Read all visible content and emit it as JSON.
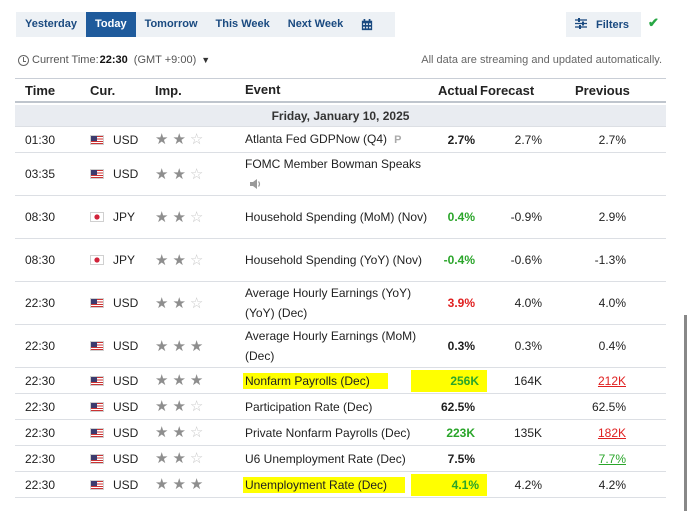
{
  "nav": {
    "tabs": [
      "Yesterday",
      "Today",
      "Tomorrow",
      "This Week",
      "Next Week"
    ],
    "active": "Today",
    "calendar_icon": "calendar-icon",
    "filters_label": "Filters",
    "filters_icon": "sliders-icon",
    "check_icon": "checkmark-icon"
  },
  "timebar": {
    "label": "Current Time:",
    "time": "22:30",
    "tz": "(GMT +9:00)",
    "streaming": "All data are streaming and updated automatically."
  },
  "columns": {
    "time": "Time",
    "cur": "Cur.",
    "imp": "Imp.",
    "event": "Event",
    "actual": "Actual",
    "forecast": "Forecast",
    "previous": "Previous"
  },
  "date_header": "Friday, January 10, 2025",
  "rows": [
    {
      "time": "01:30",
      "cur": "USD",
      "stars": 2,
      "event": "Atlanta Fed GDPNow (Q4)",
      "marker": "P",
      "actual": "2.7%",
      "forecast": "2.7%",
      "previous": "2.7%"
    },
    {
      "time": "03:35",
      "cur": "USD",
      "stars": 2,
      "event": "FOMC Member Bowman Speaks",
      "marker": "speaker-icon",
      "actual": "",
      "forecast": "",
      "previous": ""
    },
    {
      "time": "08:30",
      "cur": "JPY",
      "stars": 2,
      "event": "Household Spending (MoM) (Nov)",
      "actual": "0.4%",
      "forecast": "-0.9%",
      "previous": "2.9%"
    },
    {
      "time": "08:30",
      "cur": "JPY",
      "stars": 2,
      "event": "Household Spending (YoY) (Nov)",
      "actual": "-0.4%",
      "forecast": "-0.6%",
      "previous": "-1.3%"
    },
    {
      "time": "22:30",
      "cur": "USD",
      "stars": 2,
      "event": "Average Hourly Earnings (YoY) (YoY) (Dec)",
      "actual": "3.9%",
      "forecast": "4.0%",
      "previous": "4.0%"
    },
    {
      "time": "22:30",
      "cur": "USD",
      "stars": 3,
      "event": "Average Hourly Earnings (MoM) (Dec)",
      "actual": "0.3%",
      "forecast": "0.3%",
      "previous": "0.4%"
    },
    {
      "time": "22:30",
      "cur": "USD",
      "stars": 3,
      "event": "Nonfarm Payrolls (Dec)",
      "actual": "256K",
      "forecast": "164K",
      "previous": "212K"
    },
    {
      "time": "22:30",
      "cur": "USD",
      "stars": 2,
      "event": "Participation Rate (Dec)",
      "actual": "62.5%",
      "forecast": "",
      "previous": "62.5%"
    },
    {
      "time": "22:30",
      "cur": "USD",
      "stars": 2,
      "event": "Private Nonfarm Payrolls (Dec)",
      "actual": "223K",
      "forecast": "135K",
      "previous": "182K"
    },
    {
      "time": "22:30",
      "cur": "USD",
      "stars": 2,
      "event": "U6 Unemployment Rate (Dec)",
      "actual": "7.5%",
      "forecast": "",
      "previous": "7.7%"
    },
    {
      "time": "22:30",
      "cur": "USD",
      "stars": 3,
      "event": "Unemployment Rate (Dec)",
      "actual": "4.1%",
      "forecast": "4.2%",
      "previous": "4.2%"
    }
  ],
  "colors": {
    "accent": "#1f5b9c",
    "positive": "#2aa52a",
    "negative": "#e02020",
    "highlight": "#ffff00"
  }
}
